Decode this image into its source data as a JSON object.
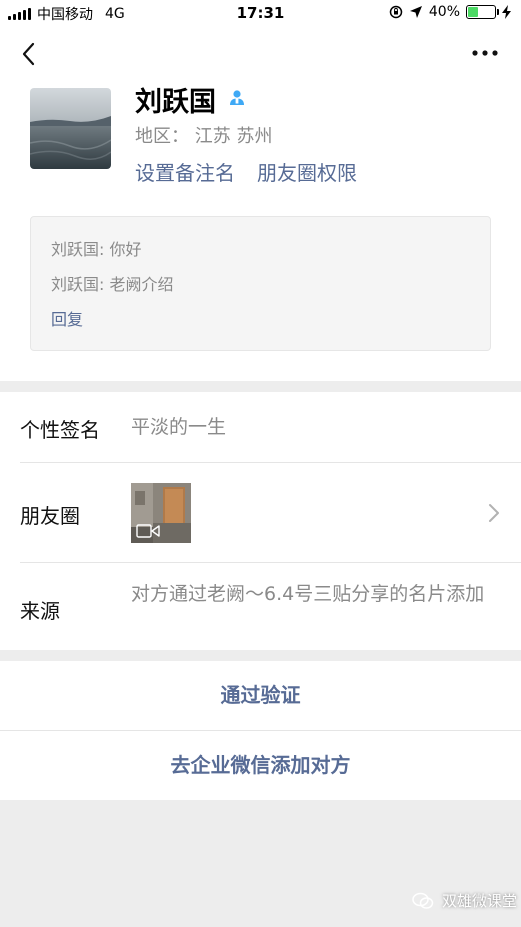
{
  "status_bar": {
    "carrier": "中国移动",
    "network": "4G",
    "time": "17:31",
    "battery": "40%",
    "battery_level": 0.4
  },
  "profile": {
    "name": "刘跃国",
    "region": "地区： 江苏 苏州",
    "set_remark_label": "设置备注名",
    "moments_permission_label": "朋友圈权限"
  },
  "messages": {
    "lines": [
      "刘跃国: 你好",
      "刘跃国: 老阙介绍"
    ],
    "reply_label": "回复"
  },
  "details": {
    "signature_label": "个性签名",
    "signature_value": "平淡的一生",
    "moments_label": "朋友圈",
    "source_label": "来源",
    "source_value": "对方通过老阙～6.4号三贴分享的名片添加"
  },
  "actions": {
    "verify_label": "通过验证",
    "enterprise_label": "去企业微信添加对方"
  },
  "watermark": {
    "text": "双雄微课堂"
  },
  "colors": {
    "link": "#576b95",
    "gray_text": "#8a8a8a",
    "battery": "#4cd964",
    "section_gap": "#ededed"
  }
}
